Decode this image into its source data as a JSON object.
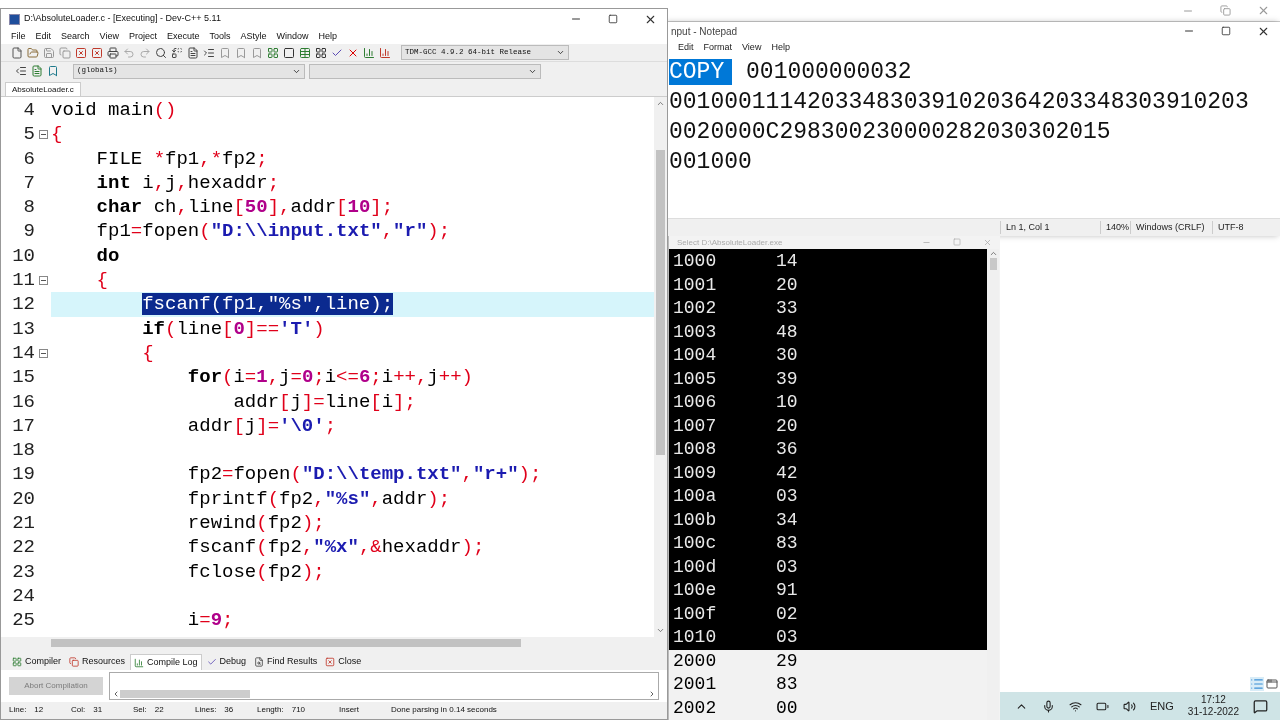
{
  "devcpp": {
    "title": "D:\\AbsoluteLoader.c - [Executing] - Dev-C++ 5.11",
    "menu": [
      "File",
      "Edit",
      "Search",
      "View",
      "Project",
      "Execute",
      "Tools",
      "AStyle",
      "Window",
      "Help"
    ],
    "compiler_select": "TDM-GCC 4.9.2 64-bit Release",
    "scope_select": "(globals)",
    "file_tabs": [
      {
        "label": "AbsoluteLoader.c",
        "selected": true
      }
    ],
    "code_lines": [
      {
        "number": "4",
        "current": false,
        "foldable": false,
        "tokens": [
          {
            "text": "void main",
            "kind": "plain"
          },
          {
            "text": "()",
            "kind": "symbol"
          }
        ]
      },
      {
        "number": "5",
        "current": false,
        "foldable": true,
        "tokens": [
          {
            "text": "{",
            "kind": "symbol"
          }
        ]
      },
      {
        "number": "6",
        "current": false,
        "foldable": false,
        "tokens": [
          {
            "text": "    FILE ",
            "kind": "plain"
          },
          {
            "text": "*",
            "kind": "symbol"
          },
          {
            "text": "fp1",
            "kind": "plain"
          },
          {
            "text": ",*",
            "kind": "symbol"
          },
          {
            "text": "fp2",
            "kind": "plain"
          },
          {
            "text": ";",
            "kind": "symbol"
          }
        ]
      },
      {
        "number": "7",
        "current": false,
        "foldable": false,
        "tokens": [
          {
            "text": "    int",
            "kind": "keyword"
          },
          {
            "text": " i",
            "kind": "plain"
          },
          {
            "text": ",",
            "kind": "symbol"
          },
          {
            "text": "j",
            "kind": "plain"
          },
          {
            "text": ",",
            "kind": "symbol"
          },
          {
            "text": "hexaddr",
            "kind": "plain"
          },
          {
            "text": ";",
            "kind": "symbol"
          }
        ]
      },
      {
        "number": "8",
        "current": false,
        "foldable": false,
        "tokens": [
          {
            "text": "    char",
            "kind": "keyword"
          },
          {
            "text": " ch",
            "kind": "plain"
          },
          {
            "text": ",",
            "kind": "symbol"
          },
          {
            "text": "line",
            "kind": "plain"
          },
          {
            "text": "[",
            "kind": "symbol"
          },
          {
            "text": "50",
            "kind": "number"
          },
          {
            "text": "],",
            "kind": "symbol"
          },
          {
            "text": "addr",
            "kind": "plain"
          },
          {
            "text": "[",
            "kind": "symbol"
          },
          {
            "text": "10",
            "kind": "number"
          },
          {
            "text": "];",
            "kind": "symbol"
          }
        ]
      },
      {
        "number": "9",
        "current": false,
        "foldable": false,
        "tokens": [
          {
            "text": "    fp1",
            "kind": "plain"
          },
          {
            "text": "=",
            "kind": "symbol"
          },
          {
            "text": "fopen",
            "kind": "plain"
          },
          {
            "text": "(",
            "kind": "symbol"
          },
          {
            "text": "\"D:\\\\input.txt\"",
            "kind": "string"
          },
          {
            "text": ",",
            "kind": "symbol"
          },
          {
            "text": "\"r\"",
            "kind": "string"
          },
          {
            "text": ");",
            "kind": "symbol"
          }
        ]
      },
      {
        "number": "10",
        "current": false,
        "foldable": false,
        "tokens": [
          {
            "text": "    do",
            "kind": "keyword"
          }
        ]
      },
      {
        "number": "11",
        "current": false,
        "foldable": true,
        "tokens": [
          {
            "text": "    {",
            "kind": "symbol"
          }
        ]
      },
      {
        "number": "12",
        "current": true,
        "foldable": false,
        "tokens": [
          {
            "text": "        fscanf(fp1,\"%s\",line);",
            "kind": "selection"
          }
        ]
      },
      {
        "number": "13",
        "current": false,
        "foldable": false,
        "tokens": [
          {
            "text": "        if",
            "kind": "keyword"
          },
          {
            "text": "(",
            "kind": "symbol"
          },
          {
            "text": "line",
            "kind": "plain"
          },
          {
            "text": "[",
            "kind": "symbol"
          },
          {
            "text": "0",
            "kind": "number"
          },
          {
            "text": "]==",
            "kind": "symbol"
          },
          {
            "text": "'T'",
            "kind": "string"
          },
          {
            "text": ")",
            "kind": "symbol"
          }
        ]
      },
      {
        "number": "14",
        "current": false,
        "foldable": true,
        "tokens": [
          {
            "text": "        {",
            "kind": "symbol"
          }
        ]
      },
      {
        "number": "15",
        "current": false,
        "foldable": false,
        "tokens": [
          {
            "text": "            for",
            "kind": "keyword"
          },
          {
            "text": "(",
            "kind": "symbol"
          },
          {
            "text": "i",
            "kind": "plain"
          },
          {
            "text": "=",
            "kind": "symbol"
          },
          {
            "text": "1",
            "kind": "number"
          },
          {
            "text": ",",
            "kind": "symbol"
          },
          {
            "text": "j",
            "kind": "plain"
          },
          {
            "text": "=",
            "kind": "symbol"
          },
          {
            "text": "0",
            "kind": "number"
          },
          {
            "text": ";",
            "kind": "symbol"
          },
          {
            "text": "i",
            "kind": "plain"
          },
          {
            "text": "<=",
            "kind": "symbol"
          },
          {
            "text": "6",
            "kind": "number"
          },
          {
            "text": ";",
            "kind": "symbol"
          },
          {
            "text": "i",
            "kind": "plain"
          },
          {
            "text": "++,",
            "kind": "symbol"
          },
          {
            "text": "j",
            "kind": "plain"
          },
          {
            "text": "++)",
            "kind": "symbol"
          }
        ]
      },
      {
        "number": "16",
        "current": false,
        "foldable": false,
        "tokens": [
          {
            "text": "                addr",
            "kind": "plain"
          },
          {
            "text": "[",
            "kind": "symbol"
          },
          {
            "text": "j",
            "kind": "plain"
          },
          {
            "text": "]=",
            "kind": "symbol"
          },
          {
            "text": "line",
            "kind": "plain"
          },
          {
            "text": "[",
            "kind": "symbol"
          },
          {
            "text": "i",
            "kind": "plain"
          },
          {
            "text": "];",
            "kind": "symbol"
          }
        ]
      },
      {
        "number": "17",
        "current": false,
        "foldable": false,
        "tokens": [
          {
            "text": "            addr",
            "kind": "plain"
          },
          {
            "text": "[",
            "kind": "symbol"
          },
          {
            "text": "j",
            "kind": "plain"
          },
          {
            "text": "]=",
            "kind": "symbol"
          },
          {
            "text": "'\\0'",
            "kind": "string"
          },
          {
            "text": ";",
            "kind": "symbol"
          }
        ]
      },
      {
        "number": "18",
        "current": false,
        "foldable": false
      },
      {
        "number": "19",
        "current": false,
        "foldable": false,
        "tokens": [
          {
            "text": "            fp2",
            "kind": "plain"
          },
          {
            "text": "=",
            "kind": "symbol"
          },
          {
            "text": "fopen",
            "kind": "plain"
          },
          {
            "text": "(",
            "kind": "symbol"
          },
          {
            "text": "\"D:\\\\temp.txt\"",
            "kind": "string"
          },
          {
            "text": ",",
            "kind": "symbol"
          },
          {
            "text": "\"r+\"",
            "kind": "string"
          },
          {
            "text": ");",
            "kind": "symbol"
          }
        ]
      },
      {
        "number": "20",
        "current": false,
        "foldable": false,
        "tokens": [
          {
            "text": "            fprintf",
            "kind": "plain"
          },
          {
            "text": "(",
            "kind": "symbol"
          },
          {
            "text": "fp2",
            "kind": "plain"
          },
          {
            "text": ",",
            "kind": "symbol"
          },
          {
            "text": "\"%s\"",
            "kind": "string"
          },
          {
            "text": ",",
            "kind": "symbol"
          },
          {
            "text": "addr",
            "kind": "plain"
          },
          {
            "text": ");",
            "kind": "symbol"
          }
        ]
      },
      {
        "number": "21",
        "current": false,
        "foldable": false,
        "tokens": [
          {
            "text": "            rewind",
            "kind": "plain"
          },
          {
            "text": "(",
            "kind": "symbol"
          },
          {
            "text": "fp2",
            "kind": "plain"
          },
          {
            "text": ");",
            "kind": "symbol"
          }
        ]
      },
      {
        "number": "22",
        "current": false,
        "foldable": false,
        "tokens": [
          {
            "text": "            fscanf",
            "kind": "plain"
          },
          {
            "text": "(",
            "kind": "symbol"
          },
          {
            "text": "fp2",
            "kind": "plain"
          },
          {
            "text": ",",
            "kind": "symbol"
          },
          {
            "text": "\"%x\"",
            "kind": "string"
          },
          {
            "text": ",&",
            "kind": "symbol"
          },
          {
            "text": "hexaddr",
            "kind": "plain"
          },
          {
            "text": ");",
            "kind": "symbol"
          }
        ]
      },
      {
        "number": "23",
        "current": false,
        "foldable": false,
        "tokens": [
          {
            "text": "            fclose",
            "kind": "plain"
          },
          {
            "text": "(",
            "kind": "symbol"
          },
          {
            "text": "fp2",
            "kind": "plain"
          },
          {
            "text": ");",
            "kind": "symbol"
          }
        ]
      },
      {
        "number": "24",
        "current": false,
        "foldable": false
      },
      {
        "number": "25",
        "current": false,
        "foldable": false,
        "tokens": [
          {
            "text": "            i",
            "kind": "plain"
          },
          {
            "text": "=",
            "kind": "symbol"
          },
          {
            "text": "9",
            "kind": "number"
          },
          {
            "text": ";",
            "kind": "symbol"
          }
        ]
      }
    ],
    "bottom_tabs": [
      {
        "label": "Compiler",
        "selected": false
      },
      {
        "label": "Resources",
        "selected": false
      },
      {
        "label": "Compile Log",
        "selected": true
      },
      {
        "label": "Debug",
        "selected": false
      },
      {
        "label": "Find Results",
        "selected": false
      },
      {
        "label": "Close",
        "selected": false
      }
    ],
    "abort_button": {
      "label": "Abort Compilation",
      "disabled": true
    },
    "status": [
      {
        "label": "Line:",
        "value": "12"
      },
      {
        "label": "Col:",
        "value": "31"
      },
      {
        "label": "Sel:",
        "value": "22"
      },
      {
        "label": "Lines:",
        "value": "36"
      },
      {
        "label": "Length:",
        "value": "710"
      }
    ],
    "mode": "Insert",
    "message": "Done parsing in 0.14 seconds"
  },
  "notepad": {
    "title": "nput - Notepad",
    "menu": [
      "Edit",
      "Format",
      "View",
      "Help"
    ],
    "lines": [
      [
        {
          "text": "COPY",
          "selected": true
        },
        {
          "text": " 001000000032",
          "selected": false
        }
      ],
      [
        {
          "text": "001000111420334830391020364203348303910203",
          "selected": false
        }
      ],
      [
        {
          "text": "0020000C298300230000282030302015",
          "selected": false
        }
      ],
      [
        {
          "text": "001000",
          "selected": false
        }
      ]
    ],
    "status": [
      "Ln 1, Col 1",
      "140%",
      "Windows (CRLF)",
      "UTF-8"
    ]
  },
  "console": {
    "title": "Select D:\\AbsoluteLoader.exe",
    "rows": [
      {
        "address": "1000",
        "value": "14",
        "selected": false
      },
      {
        "address": "1001",
        "value": "20",
        "selected": false
      },
      {
        "address": "1002",
        "value": "33",
        "selected": false
      },
      {
        "address": "1003",
        "value": "48",
        "selected": false
      },
      {
        "address": "1004",
        "value": "30",
        "selected": false
      },
      {
        "address": "1005",
        "value": "39",
        "selected": false
      },
      {
        "address": "1006",
        "value": "10",
        "selected": false
      },
      {
        "address": "1007",
        "value": "20",
        "selected": false
      },
      {
        "address": "1008",
        "value": "36",
        "selected": false
      },
      {
        "address": "1009",
        "value": "42",
        "selected": false
      },
      {
        "address": "100a",
        "value": "03",
        "selected": false
      },
      {
        "address": "100b",
        "value": "34",
        "selected": false
      },
      {
        "address": "100c",
        "value": "83",
        "selected": false
      },
      {
        "address": "100d",
        "value": "03",
        "selected": false
      },
      {
        "address": "100e",
        "value": "91",
        "selected": false
      },
      {
        "address": "100f",
        "value": "02",
        "selected": false
      },
      {
        "address": "1010",
        "value": "03",
        "selected": false
      },
      {
        "address": "2000",
        "value": "29",
        "selected": true
      },
      {
        "address": "2001",
        "value": "83",
        "selected": true
      },
      {
        "address": "2002",
        "value": "00",
        "selected": true
      }
    ]
  },
  "taskbar": {
    "language": "ENG",
    "time": "17:12",
    "date": "31-12-2022"
  }
}
